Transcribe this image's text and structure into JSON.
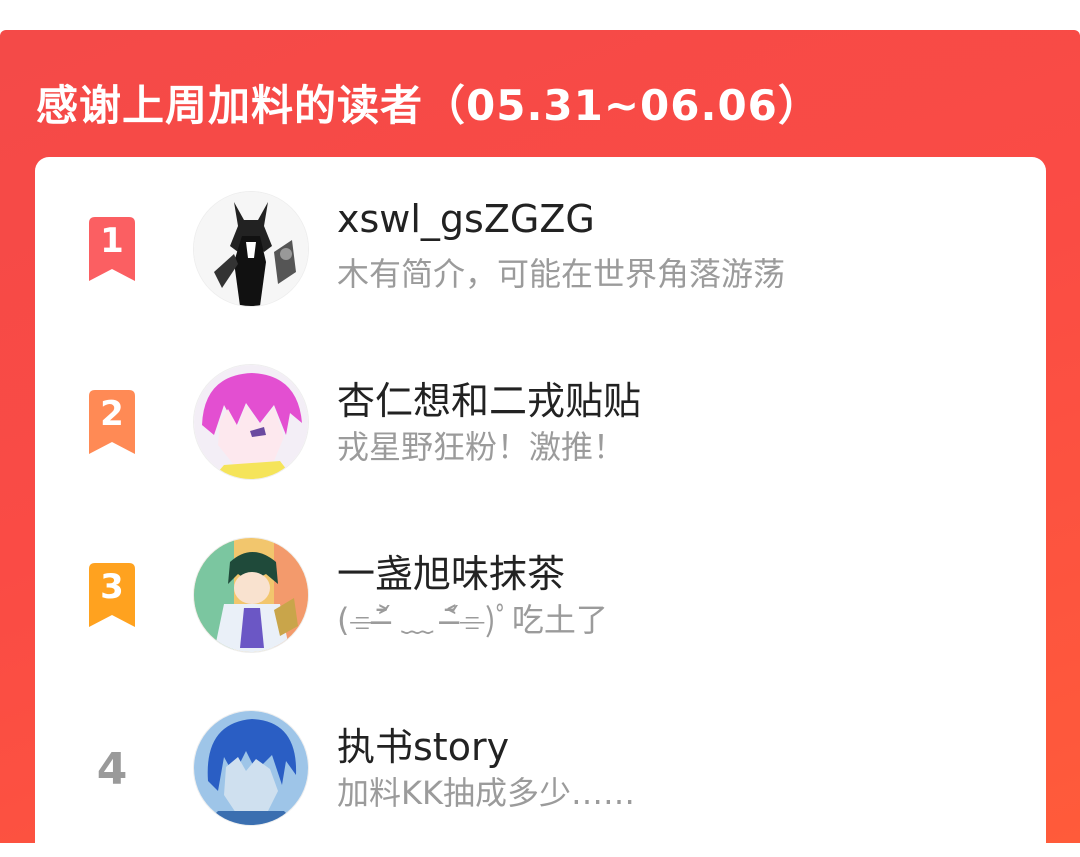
{
  "header": {
    "title": "感谢上周加料的读者（05.31~06.06）"
  },
  "readers": [
    {
      "rank": "1",
      "name": "xswl_gsZGZG",
      "bio": "木有简介，可能在世界角落游荡",
      "badge_color": "#fb5f62"
    },
    {
      "rank": "2",
      "name": "杏仁想和二戎贴贴",
      "bio": "戎星野狂粉！激推！",
      "badge_color": "#ff8a55"
    },
    {
      "rank": "3",
      "name": "一盏旭味抹茶",
      "bio": "(⌯˃̶᷄ ﹏ ˂̶᷄⌯)ﾟ吃土了",
      "badge_color": "#ffa21f"
    },
    {
      "rank": "4",
      "name": "执书story",
      "bio": "加料KK抽成多少……"
    }
  ],
  "colors": {
    "banner": "#f44a48",
    "card": "#ffffff",
    "name": "#222222",
    "bio": "#9b9b9b"
  }
}
